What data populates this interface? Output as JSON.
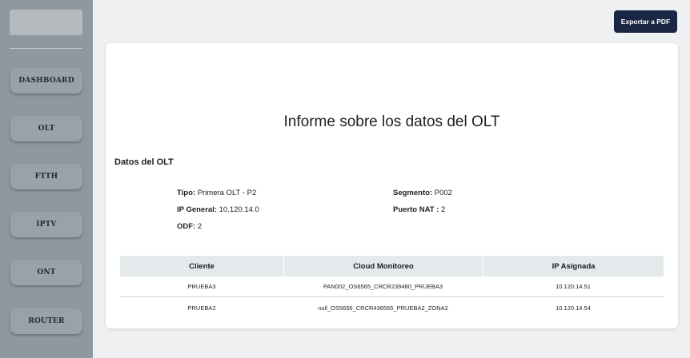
{
  "sidebar": {
    "items": [
      {
        "label": "DASHBOARD"
      },
      {
        "label": "OLT"
      },
      {
        "label": "FTTH"
      },
      {
        "label": "IPTV"
      },
      {
        "label": "ONT"
      },
      {
        "label": "ROUTER"
      }
    ]
  },
  "header": {
    "export_label": "Exportar a PDF"
  },
  "report": {
    "title": "Informe sobre los datos del OLT",
    "section_title": "Datos del OLT",
    "fields": {
      "tipo_label": "Tipo:",
      "tipo_value": "Primera OLT - P2",
      "ip_label": "IP General:",
      "ip_value": "10.120.14.0",
      "odf_label": "ODF:",
      "odf_value": "2",
      "segmento_label": "Segmento:",
      "segmento_value": "P002",
      "nat_label": "Puerto NAT :",
      "nat_value": "2"
    },
    "table": {
      "headers": [
        "Cliente",
        "Cloud Monitoreo",
        "IP Asignada"
      ],
      "rows": [
        [
          "PRUEBA3",
          "PAN002_OS6565_CRCR239480_PRUEBA3",
          "10.120.14.51"
        ],
        [
          "PRUEBA2",
          "null_OS5656_CRCR436565_PRUEBA2_ZONA2",
          "10.120.14.54"
        ]
      ]
    }
  }
}
